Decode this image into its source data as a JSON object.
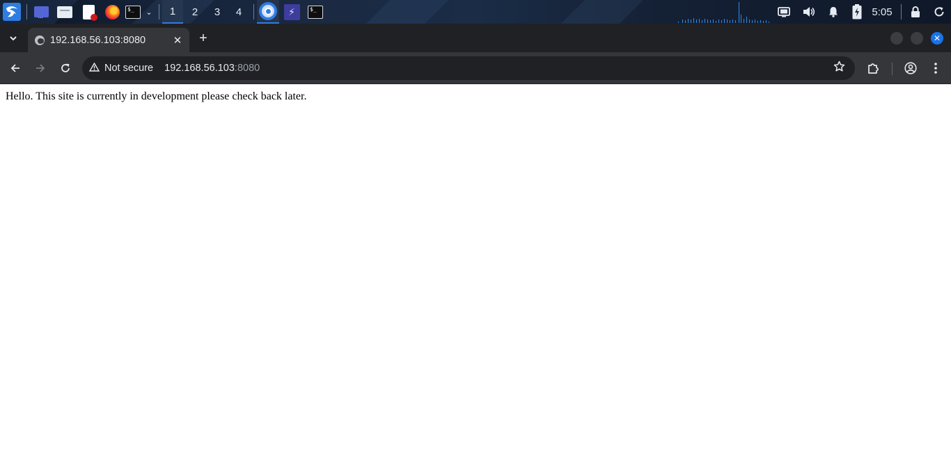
{
  "taskbar": {
    "workspaces": [
      "1",
      "2",
      "3",
      "4"
    ],
    "active_workspace": "1",
    "clock": "5:05",
    "apps": [
      "kali-menu-icon",
      "desktop-icon",
      "file-manager-icon",
      "text-editor-icon",
      "firefox-icon",
      "terminal-icon",
      "chromium-icon",
      "burp-icon",
      "terminal-icon"
    ],
    "accent_color": "#2f7de1"
  },
  "browser": {
    "tab": {
      "title": "192.168.56.103:8080",
      "close_glyph": "✕"
    },
    "new_tab_glyph": "+",
    "omnibox": {
      "security_label": "Not secure",
      "host": "192.168.56.103",
      "port": ":8080"
    }
  },
  "page": {
    "text": "Hello. This site is currently in development please check back later."
  }
}
